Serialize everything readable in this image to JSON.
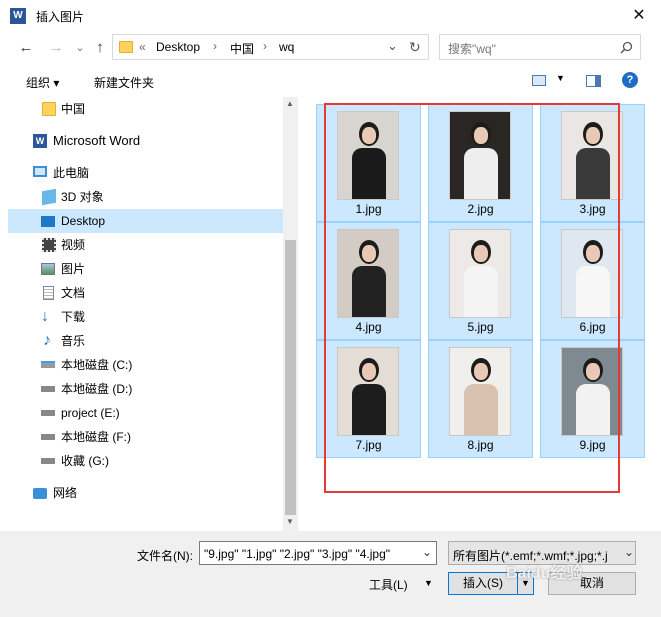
{
  "window": {
    "title": "插入图片",
    "close_glyph": "✕",
    "app_logo": "W"
  },
  "nav": {
    "back": "←",
    "forward": "→",
    "up": "↑",
    "recent": "⌄",
    "breadcrumb": [
      "«",
      "Desktop",
      "›",
      "中国",
      "›",
      "wq"
    ],
    "refresh": "↻",
    "search_placeholder": "搜索\"wq\""
  },
  "toolbar": {
    "organize": "组织 ▾",
    "new_folder": "新建文件夹",
    "help": "?"
  },
  "sidebar": {
    "items": [
      {
        "label": "中国",
        "icon": "folder-icon"
      },
      {
        "label": "Microsoft Word",
        "icon": "word-icon"
      },
      {
        "label": "此电脑",
        "icon": "computer-icon"
      },
      {
        "label": "3D 对象",
        "icon": "3d-objects-icon"
      },
      {
        "label": "Desktop",
        "icon": "desktop-icon"
      },
      {
        "label": "视频",
        "icon": "video-icon"
      },
      {
        "label": "图片",
        "icon": "pictures-icon"
      },
      {
        "label": "文档",
        "icon": "documents-icon"
      },
      {
        "label": "下载",
        "icon": "download-icon"
      },
      {
        "label": "音乐",
        "icon": "music-icon"
      },
      {
        "label": "本地磁盘 (C:)",
        "icon": "drive-icon"
      },
      {
        "label": "本地磁盘 (D:)",
        "icon": "drive-icon"
      },
      {
        "label": "project (E:)",
        "icon": "drive-icon"
      },
      {
        "label": "本地磁盘 (F:)",
        "icon": "drive-icon"
      },
      {
        "label": "收藏 (G:)",
        "icon": "drive-icon"
      },
      {
        "label": "网络",
        "icon": "network-icon"
      }
    ]
  },
  "files": [
    {
      "name": "1.jpg",
      "bg": "#d8d4d0",
      "dress": "#1a1a1a"
    },
    {
      "name": "2.jpg",
      "bg": "#2a2624",
      "dress": "#eeeeee"
    },
    {
      "name": "3.jpg",
      "bg": "#e9e6e3",
      "dress": "#3a3a3a"
    },
    {
      "name": "4.jpg",
      "bg": "#d2ccc4",
      "dress": "#222222"
    },
    {
      "name": "5.jpg",
      "bg": "#ece9e6",
      "dress": "#f4f4f4"
    },
    {
      "name": "6.jpg",
      "bg": "#dfe7f0",
      "dress": "#f7f7f7"
    },
    {
      "name": "7.jpg",
      "bg": "#e3ddd6",
      "dress": "#1d1d1d"
    },
    {
      "name": "8.jpg",
      "bg": "#f1efec",
      "dress": "#d9c3b0"
    },
    {
      "name": "9.jpg",
      "bg": "#7f8a90",
      "dress": "#f2f2f2"
    }
  ],
  "bottom": {
    "filename_label": "文件名(N):",
    "filename_value": "\"9.jpg\" \"1.jpg\" \"2.jpg\" \"3.jpg\" \"4.jpg\"",
    "filetype_value": "所有图片(*.emf;*.wmf;*.jpg;*.j",
    "tools": "工具(L)",
    "insert": "插入(S)",
    "cancel": "取消",
    "watermark": "Baidu经验"
  },
  "colors": {
    "selection": "#cce8ff",
    "selection_border": "#99d1ff",
    "annotation_box": "#e53935",
    "accent": "#0078d7"
  }
}
